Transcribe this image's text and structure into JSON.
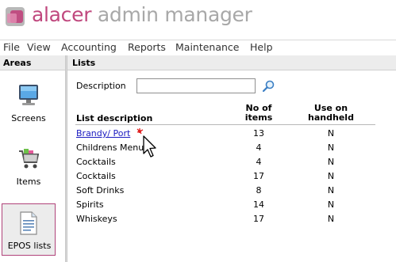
{
  "app": {
    "brand_part1": "alacer",
    "brand_part2": " admin manager"
  },
  "menu": [
    "File",
    "View",
    "Accounting",
    "Reports",
    "Maintenance",
    "Help"
  ],
  "areas": {
    "title": "Areas",
    "items": [
      {
        "label": "Screens",
        "icon": "monitor-icon"
      },
      {
        "label": "Items",
        "icon": "shopping-cart-icon"
      },
      {
        "label": "EPOS lists",
        "icon": "document-list-icon",
        "active": true
      }
    ]
  },
  "lists": {
    "title": "Lists",
    "description_label": "Description",
    "description_value": "",
    "columns": {
      "description": "List description",
      "count_line1": "No of",
      "count_line2": "items",
      "handheld_line1": "Use on",
      "handheld_line2": "handheld"
    },
    "rows": [
      {
        "name": "Brandy/ Port",
        "count": "13",
        "handheld": "N"
      },
      {
        "name": "Childrens Menu",
        "count": "4",
        "handheld": "N"
      },
      {
        "name": "Cocktails",
        "count": "4",
        "handheld": "N"
      },
      {
        "name": "Cocktails",
        "count": "17",
        "handheld": "N"
      },
      {
        "name": "Soft  Drinks",
        "count": "8",
        "handheld": "N"
      },
      {
        "name": "Spirits",
        "count": "14",
        "handheld": "N"
      },
      {
        "name": "Whiskeys",
        "count": "17",
        "handheld": "N"
      }
    ]
  },
  "colors": {
    "brand_pink": "#c0487e",
    "brand_grey": "#a8a8a8",
    "link_blue": "#1a1ac0",
    "active_border": "#b0437a"
  }
}
